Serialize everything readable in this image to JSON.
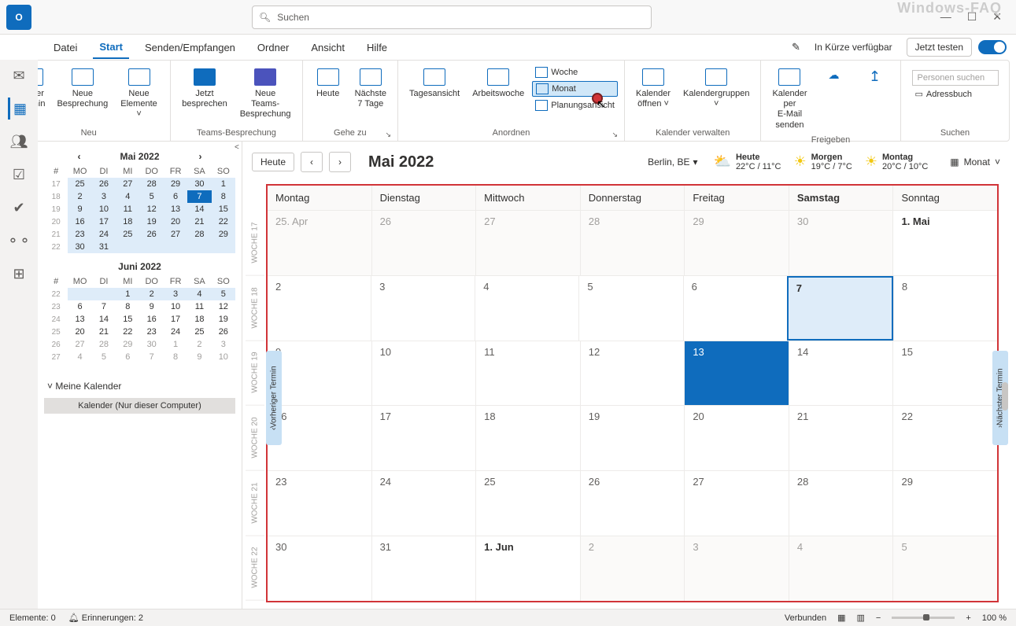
{
  "app_title": "O",
  "watermark": "Windows-FAQ",
  "search": {
    "placeholder": "Suchen"
  },
  "window_controls": {
    "min": "—",
    "max": "☐",
    "close": "✕"
  },
  "menubar": {
    "tabs": [
      "Datei",
      "Start",
      "Senden/Empfangen",
      "Ordner",
      "Ansicht",
      "Hilfe"
    ],
    "active": "Start",
    "coming_soon": "In Kürze verfügbar",
    "try_now": "Jetzt testen"
  },
  "ribbon": {
    "groups": {
      "neu": {
        "label": "Neu",
        "items": [
          "Neuer\nTermin",
          "Neue\nBesprechung",
          "Neue\nElemente ˅"
        ]
      },
      "teams": {
        "label": "Teams-Besprechung",
        "items": [
          "Jetzt\nbesprechen",
          "Neue Teams-\nBesprechung"
        ]
      },
      "gehezu": {
        "label": "Gehe zu",
        "items": [
          "Heute",
          "Nächste\n7 Tage"
        ]
      },
      "anordnen": {
        "label": "Anordnen",
        "big": [
          "Tagesansicht",
          "Arbeitswoche"
        ],
        "small": [
          "Woche",
          "Monat",
          "Planungsansicht"
        ]
      },
      "verwalten": {
        "label": "Kalender verwalten",
        "items": [
          "Kalender\nöffnen ˅",
          "Kalendergruppen\n˅"
        ]
      },
      "freigeben": {
        "label": "Freigeben",
        "items": [
          "Kalender per\nE-Mail senden"
        ]
      },
      "suchen": {
        "label": "Suchen",
        "items": [
          "Personen suchen",
          "Adressbuch"
        ]
      }
    }
  },
  "side_rail": [
    "mail",
    "calendar",
    "people",
    "tasks",
    "todo",
    "org",
    "apps"
  ],
  "nav": {
    "cal1": {
      "title": "Mai 2022",
      "dow": [
        "#",
        "MO",
        "DI",
        "MI",
        "DO",
        "FR",
        "SA",
        "SO"
      ],
      "rows": [
        [
          "17",
          "25",
          "26",
          "27",
          "28",
          "29",
          "30",
          "1"
        ],
        [
          "18",
          "2",
          "3",
          "4",
          "5",
          "6",
          "7",
          "8"
        ],
        [
          "19",
          "9",
          "10",
          "11",
          "12",
          "13",
          "14",
          "15"
        ],
        [
          "20",
          "16",
          "17",
          "18",
          "19",
          "20",
          "21",
          "22"
        ],
        [
          "21",
          "23",
          "24",
          "25",
          "26",
          "27",
          "28",
          "29"
        ],
        [
          "22",
          "30",
          "31",
          "",
          "",
          "",
          "",
          ""
        ]
      ]
    },
    "cal2": {
      "title": "Juni 2022",
      "dow": [
        "#",
        "MO",
        "DI",
        "MI",
        "DO",
        "FR",
        "SA",
        "SO"
      ],
      "rows": [
        [
          "22",
          "",
          "",
          "1",
          "2",
          "3",
          "4",
          "5"
        ],
        [
          "23",
          "6",
          "7",
          "8",
          "9",
          "10",
          "11",
          "12"
        ],
        [
          "24",
          "13",
          "14",
          "15",
          "16",
          "17",
          "18",
          "19"
        ],
        [
          "25",
          "20",
          "21",
          "22",
          "23",
          "24",
          "25",
          "26"
        ],
        [
          "26",
          "27",
          "28",
          "29",
          "30",
          "1",
          "2",
          "3"
        ],
        [
          "27",
          "4",
          "5",
          "6",
          "7",
          "8",
          "9",
          "10"
        ]
      ]
    },
    "section": {
      "title": "Meine Kalender",
      "selected": "Kalender (Nur dieser Computer)"
    }
  },
  "toolbar": {
    "today": "Heute",
    "title": "Mai 2022",
    "location": "Berlin, BE",
    "weather": [
      {
        "label": "Heute",
        "temp": "22°C / 11°C",
        "icon": "cloud"
      },
      {
        "label": "Morgen",
        "temp": "19°C / 7°C",
        "icon": "sun"
      },
      {
        "label": "Montag",
        "temp": "20°C / 10°C",
        "icon": "sun"
      }
    ],
    "view": "Monat"
  },
  "grid": {
    "day_headers": [
      "Montag",
      "Dienstag",
      "Mittwoch",
      "Donnerstag",
      "Freitag",
      "Samstag",
      "Sonntag"
    ],
    "today_col": 5,
    "week_labels": [
      "WOCHE 17",
      "WOCHE 18",
      "WOCHE 19",
      "WOCHE 20",
      "WOCHE 21",
      "WOCHE 22"
    ],
    "rows": [
      [
        {
          "t": "25. Apr",
          "o": true
        },
        {
          "t": "26",
          "o": true
        },
        {
          "t": "27",
          "o": true
        },
        {
          "t": "28",
          "o": true
        },
        {
          "t": "29",
          "o": true
        },
        {
          "t": "30",
          "o": true
        },
        {
          "t": "1. Mai",
          "b": true
        }
      ],
      [
        {
          "t": "2"
        },
        {
          "t": "3"
        },
        {
          "t": "4"
        },
        {
          "t": "5"
        },
        {
          "t": "6"
        },
        {
          "t": "7",
          "today": true
        },
        {
          "t": "8"
        }
      ],
      [
        {
          "t": "9"
        },
        {
          "t": "10"
        },
        {
          "t": "11"
        },
        {
          "t": "12"
        },
        {
          "t": "13",
          "sel": true
        },
        {
          "t": "14"
        },
        {
          "t": "15"
        }
      ],
      [
        {
          "t": "16"
        },
        {
          "t": "17"
        },
        {
          "t": "18"
        },
        {
          "t": "19"
        },
        {
          "t": "20"
        },
        {
          "t": "21"
        },
        {
          "t": "22"
        }
      ],
      [
        {
          "t": "23"
        },
        {
          "t": "24"
        },
        {
          "t": "25"
        },
        {
          "t": "26"
        },
        {
          "t": "27"
        },
        {
          "t": "28"
        },
        {
          "t": "29"
        }
      ],
      [
        {
          "t": "30"
        },
        {
          "t": "31"
        },
        {
          "t": "1. Jun",
          "b": true
        },
        {
          "t": "2",
          "o": true
        },
        {
          "t": "3",
          "o": true
        },
        {
          "t": "4",
          "o": true
        },
        {
          "t": "5",
          "o": true
        }
      ]
    ],
    "prev": "Vorheriger Termin",
    "next": "Nächster Termin"
  },
  "status": {
    "elements": "Elemente: 0",
    "reminders": "Erinnerungen: 2",
    "connected": "Verbunden",
    "zoom": "100 %"
  }
}
